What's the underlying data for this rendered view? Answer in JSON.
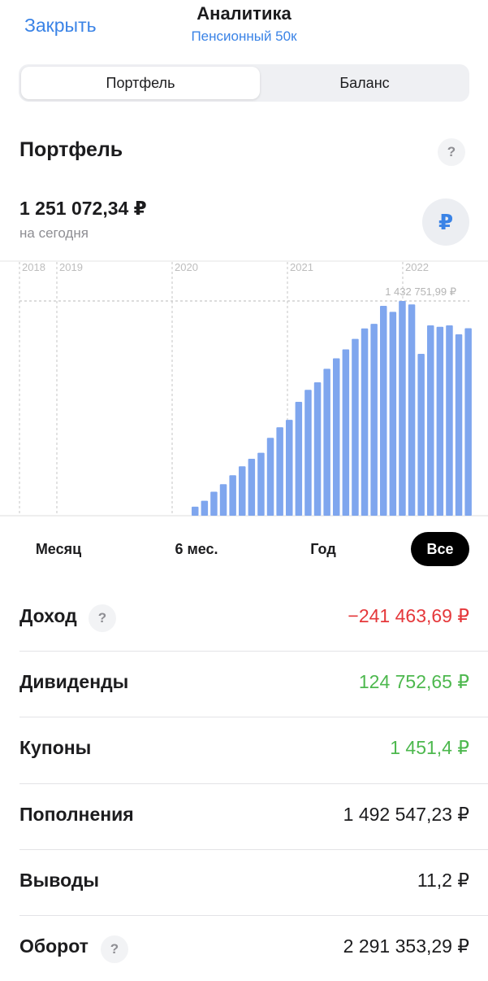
{
  "header": {
    "close_label": "Закрыть",
    "title": "Аналитика",
    "subtitle": "Пенсионный 50к"
  },
  "tabs": {
    "active": "Портфель",
    "inactive": "Баланс"
  },
  "portfolio": {
    "title": "Портфель",
    "help": "?",
    "value": "1 251 072,34 ₽",
    "value_caption": "на сегодня",
    "currency_icon": "₽"
  },
  "chart_data": {
    "type": "bar",
    "year_labels": [
      "2018",
      "2019",
      "2020",
      "2021",
      "2022"
    ],
    "max_label": "1 432 751,99 ₽",
    "max_value": 1432751.99,
    "ylim": [
      0,
      1432751.99
    ],
    "values": [
      60000,
      100000,
      160000,
      210000,
      270000,
      330000,
      380000,
      420000,
      520000,
      590000,
      640000,
      760000,
      840000,
      890000,
      980000,
      1050000,
      1110000,
      1180000,
      1250000,
      1280000,
      1400000,
      1360000,
      1432751.99,
      1410000,
      1080000,
      1270000,
      1260000,
      1270000,
      1210000,
      1251072.34
    ],
    "color": "#7fa6ee"
  },
  "periods": {
    "month": "Месяц",
    "six_months": "6 мес.",
    "year": "Год",
    "all": "Все"
  },
  "stats": {
    "income_label": "Доход",
    "income_value": "−241 463,69 ₽",
    "dividends_label": "Дивиденды",
    "dividends_value": "124 752,65 ₽",
    "coupons_label": "Купоны",
    "coupons_value": "1 451,4 ₽",
    "deposits_label": "Пополнения",
    "deposits_value": "1 492 547,23 ₽",
    "withdrawals_label": "Выводы",
    "withdrawals_value": "11,2 ₽",
    "turnover_label": "Оборот",
    "turnover_value": "2 291 353,29 ₽"
  },
  "colors": {
    "accent": "#3a83e6",
    "positive": "#4db84e",
    "negative": "#e5383b"
  }
}
